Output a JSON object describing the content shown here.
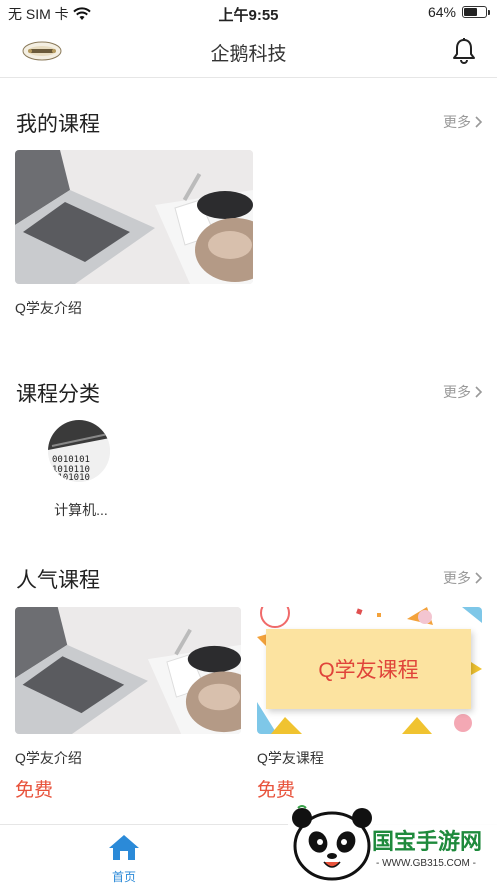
{
  "status_bar": {
    "carrier": "无 SIM 卡",
    "time": "上午9:55",
    "battery": "64%",
    "battery_level": 0.64
  },
  "nav": {
    "title": "企鹅科技"
  },
  "sections": {
    "my_courses": {
      "title": "我的课程",
      "more": "更多",
      "items": [
        {
          "caption": "Q学友介绍"
        }
      ]
    },
    "categories": {
      "title": "课程分类",
      "more": "更多",
      "items": [
        {
          "label": "计算机...",
          "image_text": "0101010\n0010101\n1010110"
        }
      ]
    },
    "popular": {
      "title": "人气课程",
      "more": "更多",
      "items": [
        {
          "caption": "Q学友介绍",
          "price": "免费"
        },
        {
          "caption": "Q学友课程",
          "price": "免费",
          "banner_text": "Q学友课程"
        }
      ]
    }
  },
  "tab_bar": {
    "home_label": "首页"
  },
  "watermark": {
    "brand": "国宝手游网",
    "url": "- WWW.GB315.COM -"
  },
  "colors": {
    "accent": "#2b8ad8",
    "price": "#e8533c",
    "banner_bg": "#fce3a0",
    "banner_text": "#e0443a"
  }
}
